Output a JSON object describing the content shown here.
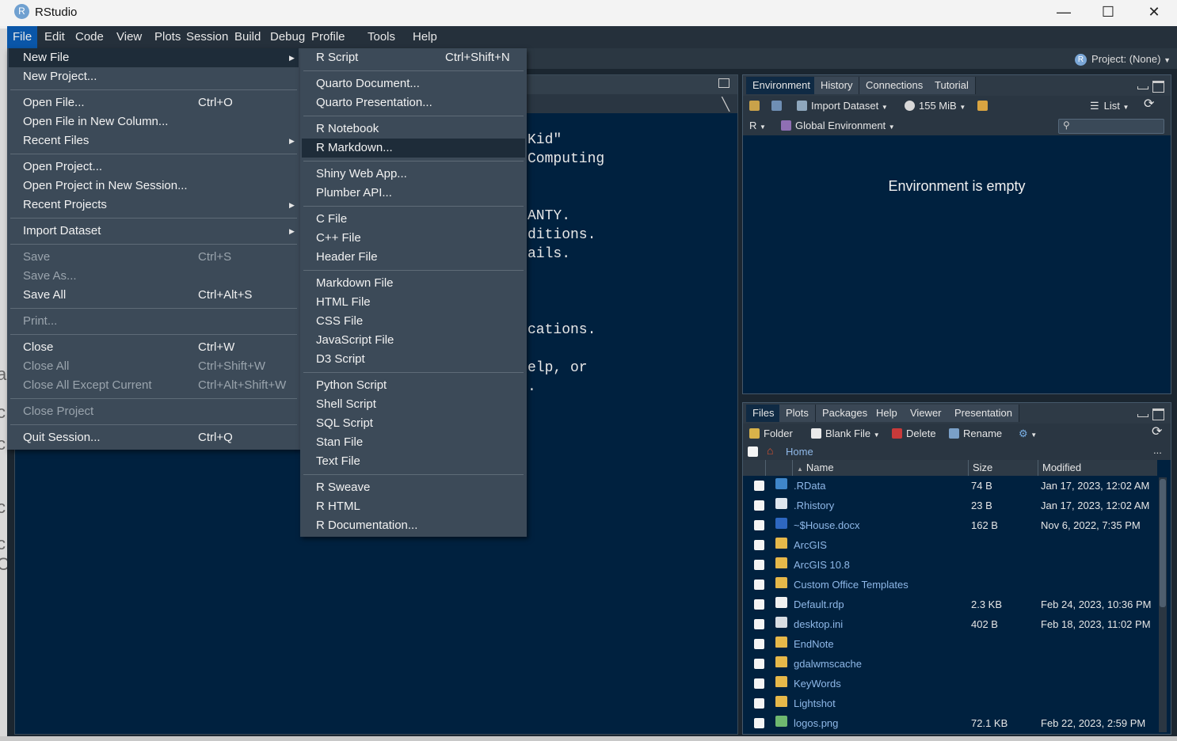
{
  "window": {
    "title": "RStudio",
    "logo_letter": "R"
  },
  "menubar": [
    "File",
    "Edit",
    "Code",
    "View",
    "Plots",
    "Session",
    "Build",
    "Debug",
    "Profile",
    "Tools",
    "Help"
  ],
  "project_label": "Project: (None)",
  "console_lines": [
    "Kid\"",
    "Computing",
    "ANTY.",
    "ditions.",
    "ails.",
    "cations.",
    "elp, or",
    "."
  ],
  "left_fragments": [
    "a",
    "c",
    "c",
    "c",
    "c",
    "C"
  ],
  "file_menu": [
    {
      "label": "New File",
      "shortcut": "",
      "disabled": false,
      "submenu": true,
      "highlight": true
    },
    {
      "label": "New Project...",
      "shortcut": "",
      "disabled": false
    },
    {
      "sep": true
    },
    {
      "label": "Open File...",
      "shortcut": "Ctrl+O",
      "disabled": false
    },
    {
      "label": "Open File in New Column...",
      "shortcut": "",
      "disabled": false
    },
    {
      "label": "Recent Files",
      "shortcut": "",
      "disabled": false,
      "submenu": true
    },
    {
      "sep": true
    },
    {
      "label": "Open Project...",
      "shortcut": "",
      "disabled": false
    },
    {
      "label": "Open Project in New Session...",
      "shortcut": "",
      "disabled": false
    },
    {
      "label": "Recent Projects",
      "shortcut": "",
      "disabled": false,
      "submenu": true
    },
    {
      "sep": true
    },
    {
      "label": "Import Dataset",
      "shortcut": "",
      "disabled": false,
      "submenu": true
    },
    {
      "sep": true
    },
    {
      "label": "Save",
      "shortcut": "Ctrl+S",
      "disabled": true
    },
    {
      "label": "Save As...",
      "shortcut": "",
      "disabled": true
    },
    {
      "label": "Save All",
      "shortcut": "Ctrl+Alt+S",
      "disabled": false
    },
    {
      "sep": true
    },
    {
      "label": "Print...",
      "shortcut": "",
      "disabled": true
    },
    {
      "sep": true
    },
    {
      "label": "Close",
      "shortcut": "Ctrl+W",
      "disabled": false
    },
    {
      "label": "Close All",
      "shortcut": "Ctrl+Shift+W",
      "disabled": true
    },
    {
      "label": "Close All Except Current",
      "shortcut": "Ctrl+Alt+Shift+W",
      "disabled": true
    },
    {
      "sep": true
    },
    {
      "label": "Close Project",
      "shortcut": "",
      "disabled": true
    },
    {
      "sep": true
    },
    {
      "label": "Quit Session...",
      "shortcut": "Ctrl+Q",
      "disabled": false
    }
  ],
  "newfile_menu": [
    {
      "label": "R Script",
      "shortcut": "Ctrl+Shift+N"
    },
    {
      "sep": true
    },
    {
      "label": "Quarto Document...",
      "shortcut": ""
    },
    {
      "label": "Quarto Presentation...",
      "shortcut": ""
    },
    {
      "sep": true
    },
    {
      "label": "R Notebook",
      "shortcut": ""
    },
    {
      "label": "R Markdown...",
      "shortcut": "",
      "highlight": true
    },
    {
      "sep": true
    },
    {
      "label": "Shiny Web App...",
      "shortcut": ""
    },
    {
      "label": "Plumber API...",
      "shortcut": ""
    },
    {
      "sep": true
    },
    {
      "label": "C File",
      "shortcut": ""
    },
    {
      "label": "C++ File",
      "shortcut": ""
    },
    {
      "label": "Header File",
      "shortcut": ""
    },
    {
      "sep": true
    },
    {
      "label": "Markdown File",
      "shortcut": ""
    },
    {
      "label": "HTML File",
      "shortcut": ""
    },
    {
      "label": "CSS File",
      "shortcut": ""
    },
    {
      "label": "JavaScript File",
      "shortcut": ""
    },
    {
      "label": "D3 Script",
      "shortcut": ""
    },
    {
      "sep": true
    },
    {
      "label": "Python Script",
      "shortcut": ""
    },
    {
      "label": "Shell Script",
      "shortcut": ""
    },
    {
      "label": "SQL Script",
      "shortcut": ""
    },
    {
      "label": "Stan File",
      "shortcut": ""
    },
    {
      "label": "Text File",
      "shortcut": ""
    },
    {
      "sep": true
    },
    {
      "label": "R Sweave",
      "shortcut": ""
    },
    {
      "label": "R HTML",
      "shortcut": ""
    },
    {
      "label": "R Documentation...",
      "shortcut": ""
    }
  ],
  "env_pane": {
    "tabs": [
      "Environment",
      "History",
      "Connections",
      "Tutorial"
    ],
    "import_dataset": "Import Dataset",
    "memory": "155 MiB",
    "list_label": "List",
    "lang": "R",
    "scope": "Global Environment",
    "empty_message": "Environment is empty"
  },
  "files_pane": {
    "tabs": [
      "Files",
      "Plots",
      "Packages",
      "Help",
      "Viewer",
      "Presentation"
    ],
    "toolbar": {
      "folder": "Folder",
      "blank_file": "Blank File",
      "delete": "Delete",
      "rename": "Rename"
    },
    "path": "Home",
    "headers": {
      "name": "Name",
      "size": "Size",
      "modified": "Modified"
    },
    "rows": [
      {
        "name": ".RData",
        "size": "74 B",
        "modified": "Jan 17, 2023, 12:02 AM",
        "icon": "rdata-file-icon"
      },
      {
        "name": ".Rhistory",
        "size": "23 B",
        "modified": "Jan 17, 2023, 12:02 AM",
        "icon": "rhistory-file-icon"
      },
      {
        "name": "~$House.docx",
        "size": "162 B",
        "modified": "Nov 6, 2022, 7:35 PM",
        "icon": "word-file-icon"
      },
      {
        "name": "ArcGIS",
        "size": "",
        "modified": "",
        "icon": "folder-icon"
      },
      {
        "name": "ArcGIS 10.8",
        "size": "",
        "modified": "",
        "icon": "folder-icon"
      },
      {
        "name": "Custom Office Templates",
        "size": "",
        "modified": "",
        "icon": "folder-icon"
      },
      {
        "name": "Default.rdp",
        "size": "2.3 KB",
        "modified": "Feb 24, 2023, 10:36 PM",
        "icon": "file-icon"
      },
      {
        "name": "desktop.ini",
        "size": "402 B",
        "modified": "Feb 18, 2023, 11:02 PM",
        "icon": "ini-file-icon"
      },
      {
        "name": "EndNote",
        "size": "",
        "modified": "",
        "icon": "folder-icon"
      },
      {
        "name": "gdalwmscache",
        "size": "",
        "modified": "",
        "icon": "folder-icon"
      },
      {
        "name": "KeyWords",
        "size": "",
        "modified": "",
        "icon": "folder-icon"
      },
      {
        "name": "Lightshot",
        "size": "",
        "modified": "",
        "icon": "folder-icon"
      },
      {
        "name": "logos.png",
        "size": "72.1 KB",
        "modified": "Feb 22, 2023, 2:59 PM",
        "icon": "image-file-icon"
      }
    ]
  }
}
